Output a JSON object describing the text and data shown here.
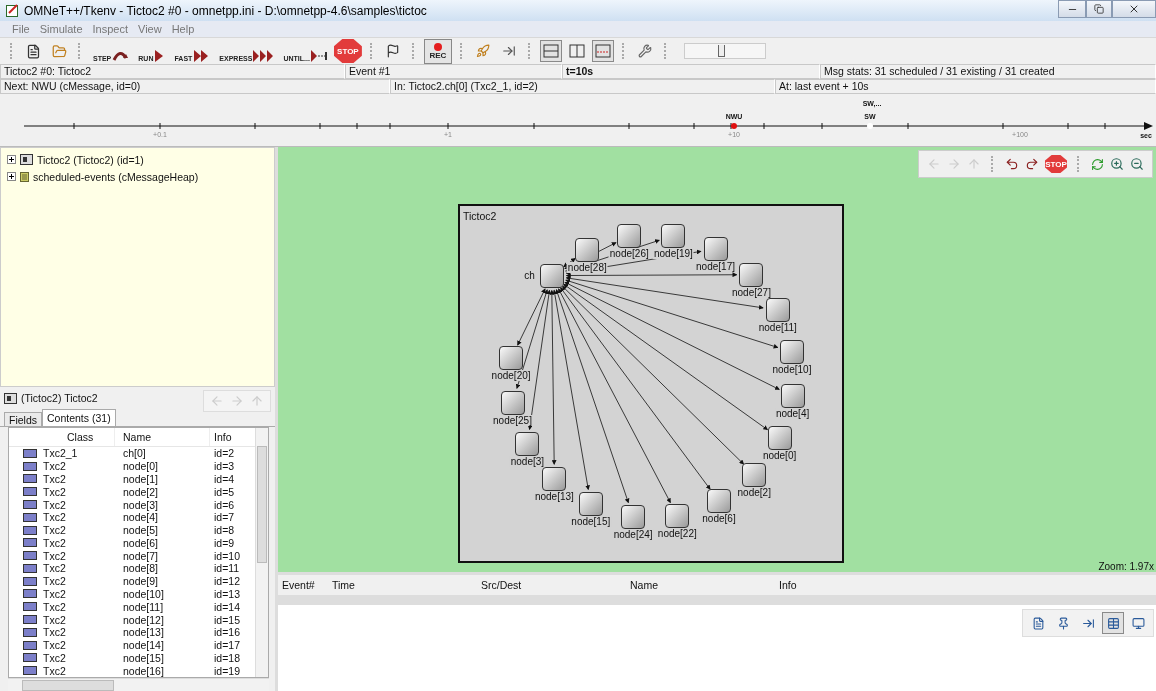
{
  "window": {
    "title": "OMNeT++/Tkenv - Tictoc2 #0 - omnetpp.ini - D:\\omnetpp-4.6\\samples\\tictoc"
  },
  "menu": [
    "File",
    "Simulate",
    "Inspect",
    "View",
    "Help"
  ],
  "run_buttons": [
    {
      "label": "STEP"
    },
    {
      "label": "RUN"
    },
    {
      "label": "FAST"
    },
    {
      "label": "EXPRESS"
    },
    {
      "label": "UNTIL..."
    },
    {
      "label": "STOP"
    }
  ],
  "record_button": {
    "label": "REC",
    "pressed": true
  },
  "layout_toggles": [
    {
      "pressed": true
    },
    {
      "pressed": false
    },
    {
      "pressed": true
    }
  ],
  "speed_slider": {
    "level": 0.45
  },
  "status_row_1": [
    "Tictoc2 #0: Tictoc2",
    "Event #1",
    "t=10s",
    "Msg stats: 31 scheduled / 31 existing / 31 created"
  ],
  "status_row_2": [
    "Next: NWU (cMessage, id=0)",
    "In: Tictoc2.ch[0] (Txc2_1, id=2)",
    "At: last event + 10s"
  ],
  "timeline": {
    "ticks": [
      "+0.1",
      "+1",
      "+10",
      "+100"
    ],
    "unit": "sec",
    "events": [
      {
        "label": "NWU",
        "color": "#e01010"
      },
      {
        "label": "SW",
        "color": "#ffffff"
      }
    ],
    "stack_label": "SW,..."
  },
  "tree": [
    {
      "label": "Tictoc2 (Tictoc2) (id=1)",
      "expanded": false
    },
    {
      "label": "scheduled-events (cMessageHeap)",
      "expanded": false
    }
  ],
  "inspector": {
    "title": "(Tictoc2) Tictoc2",
    "tabs": [
      {
        "label": "Fields",
        "selected": false
      },
      {
        "label": "Contents (31)",
        "selected": true
      }
    ],
    "columns": [
      "Class",
      "Name",
      "Info"
    ],
    "rows": [
      {
        "class": "Txc2_1",
        "name": "ch[0]",
        "info": "id=2"
      },
      {
        "class": "Txc2",
        "name": "node[0]",
        "info": "id=3"
      },
      {
        "class": "Txc2",
        "name": "node[1]",
        "info": "id=4"
      },
      {
        "class": "Txc2",
        "name": "node[2]",
        "info": "id=5"
      },
      {
        "class": "Txc2",
        "name": "node[3]",
        "info": "id=6"
      },
      {
        "class": "Txc2",
        "name": "node[4]",
        "info": "id=7"
      },
      {
        "class": "Txc2",
        "name": "node[5]",
        "info": "id=8"
      },
      {
        "class": "Txc2",
        "name": "node[6]",
        "info": "id=9"
      },
      {
        "class": "Txc2",
        "name": "node[7]",
        "info": "id=10"
      },
      {
        "class": "Txc2",
        "name": "node[8]",
        "info": "id=11"
      },
      {
        "class": "Txc2",
        "name": "node[9]",
        "info": "id=12"
      },
      {
        "class": "Txc2",
        "name": "node[10]",
        "info": "id=13"
      },
      {
        "class": "Txc2",
        "name": "node[11]",
        "info": "id=14"
      },
      {
        "class": "Txc2",
        "name": "node[12]",
        "info": "id=15"
      },
      {
        "class": "Txc2",
        "name": "node[13]",
        "info": "id=16"
      },
      {
        "class": "Txc2",
        "name": "node[14]",
        "info": "id=17"
      },
      {
        "class": "Txc2",
        "name": "node[15]",
        "info": "id=18"
      },
      {
        "class": "Txc2",
        "name": "node[16]",
        "info": "id=19"
      }
    ]
  },
  "network": {
    "title": "Tictoc2",
    "hub_label": "ch",
    "nodes": [
      "node[19]",
      "node[26]",
      "node[17]",
      "node[28]",
      "node[27]",
      "node[11]",
      "node[10]",
      "node[20]",
      "node[4]",
      "node[25]",
      "node[0]",
      "node[3]",
      "node[2]",
      "node[13]",
      "node[6]",
      "node[15]",
      "node[22]",
      "node[24]"
    ],
    "stop_label": "STOP",
    "zoom": "Zoom: 1.97x"
  },
  "event_log": {
    "columns": [
      "Event#",
      "Time",
      "Src/Dest",
      "Name",
      "Info"
    ],
    "toolbar": [
      {
        "pressed": false
      },
      {
        "pressed": false
      },
      {
        "pressed": false
      },
      {
        "pressed": true
      },
      {
        "pressed": false
      }
    ]
  }
}
